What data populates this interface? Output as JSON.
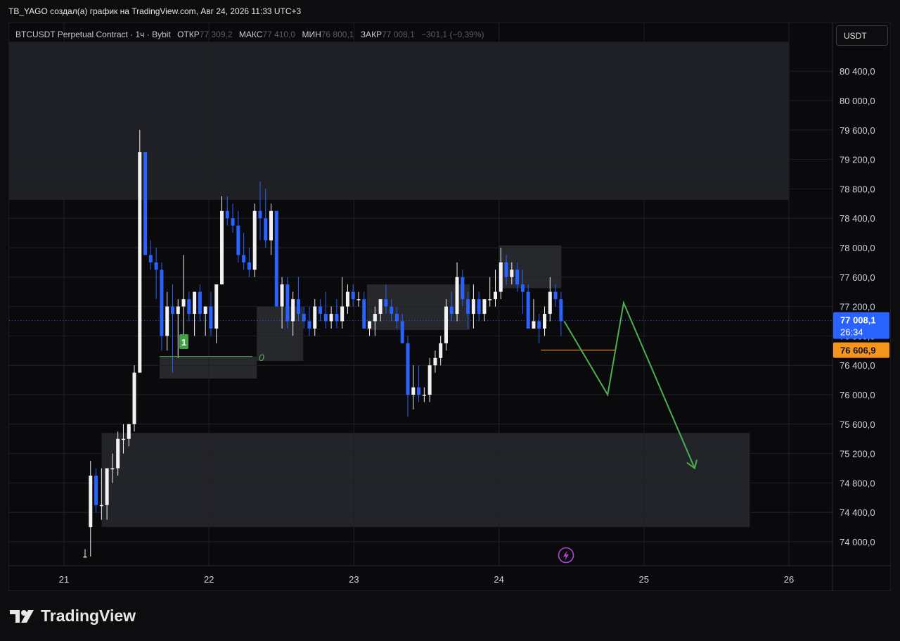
{
  "header": {
    "caption": "TB_YAGO создал(а) график на TradingView.com, Авг 24, 2026 11:33 UTC+3"
  },
  "legend": {
    "symbol": "BTCUSDT Perpetual Contract · 1ч · Bybit",
    "open_label": "ОТКР",
    "open_value": "77 309,2",
    "high_label": "МАКС",
    "high_value": "77 410,0",
    "low_label": "МИН",
    "low_value": "76 800,1",
    "close_label": "ЗАКР",
    "close_value": "77 008,1",
    "change_value": "−301,1 (−0,39%)"
  },
  "currency_button": "USDT",
  "price_badges": {
    "last_price": "77 008,1",
    "countdown": "26:34",
    "level_price": "76 606,9"
  },
  "markers": {
    "box_number": "1",
    "box_letter": "0"
  },
  "branding": {
    "name": "TradingView"
  },
  "icons": {
    "flash_icon": "lightning-icon",
    "logo_icon": "tradingview-logo-icon"
  },
  "colors": {
    "bull": "#f2f2f2",
    "bear": "#2962ff",
    "grid": "#1f2026",
    "zone": "#26272c",
    "zone_dark": "#34353b",
    "arrow": "#4caf50",
    "level_line": "#f5941d",
    "last_price_badge": "#2962ff",
    "level_badge": "#f5941d",
    "price_line": "#2962ff",
    "flash_icon": "#a64ad6"
  },
  "chart_data": {
    "type": "candlestick",
    "timeframe": "1h",
    "ylim": [
      73800,
      80800
    ],
    "y_ticks": [
      74000,
      74400,
      74800,
      75200,
      75600,
      76000,
      76400,
      76800,
      77200,
      77600,
      78000,
      78400,
      78800,
      79200,
      79600,
      80000,
      80400
    ],
    "y_tick_labels": [
      "74 000,0",
      "74 400,0",
      "74 800,0",
      "75 200,0",
      "75 600,0",
      "76 000,0",
      "76 400,0",
      "76 800,0",
      "77 200,0",
      "77 600,0",
      "78 000,0",
      "78 400,0",
      "78 800,0",
      "79 200,0",
      "79 600,0",
      "80 000,0",
      "80 400,0"
    ],
    "x_range": [
      20.25,
      26.0
    ],
    "x_ticks": [
      21,
      22,
      23,
      24,
      25,
      26
    ],
    "x_tick_labels": [
      "21",
      "22",
      "23",
      "24",
      "25",
      "26"
    ],
    "candles": [
      {
        "o": 73800,
        "h": 73900,
        "l": 73800,
        "c": 73800
      },
      {
        "o": 74200,
        "h": 75100,
        "l": 73800,
        "c": 74900
      },
      {
        "o": 74900,
        "h": 75000,
        "l": 74400,
        "c": 74500
      },
      {
        "o": 74500,
        "h": 75000,
        "l": 74300,
        "c": 74500
      },
      {
        "o": 74500,
        "h": 75000,
        "l": 74300,
        "c": 75000
      },
      {
        "o": 75000,
        "h": 75200,
        "l": 74800,
        "c": 75000
      },
      {
        "o": 75000,
        "h": 75500,
        "l": 74900,
        "c": 75400
      },
      {
        "o": 75400,
        "h": 75600,
        "l": 75200,
        "c": 75400
      },
      {
        "o": 75400,
        "h": 75600,
        "l": 75300,
        "c": 75600
      },
      {
        "o": 75600,
        "h": 76400,
        "l": 75500,
        "c": 76300
      },
      {
        "o": 76300,
        "h": 79600,
        "l": 76300,
        "c": 79300
      },
      {
        "o": 79300,
        "h": 79300,
        "l": 77900,
        "c": 77900
      },
      {
        "o": 77900,
        "h": 78100,
        "l": 77700,
        "c": 77800
      },
      {
        "o": 77800,
        "h": 78000,
        "l": 77300,
        "c": 77700
      },
      {
        "o": 77700,
        "h": 77800,
        "l": 76600,
        "c": 76800
      },
      {
        "o": 76800,
        "h": 77400,
        "l": 76600,
        "c": 77200
      },
      {
        "o": 77200,
        "h": 77500,
        "l": 76300,
        "c": 77100
      },
      {
        "o": 77100,
        "h": 77300,
        "l": 76500,
        "c": 77200
      },
      {
        "o": 77200,
        "h": 77900,
        "l": 76700,
        "c": 77300
      },
      {
        "o": 77300,
        "h": 77400,
        "l": 77000,
        "c": 77100
      },
      {
        "o": 77100,
        "h": 77400,
        "l": 76800,
        "c": 77400
      },
      {
        "o": 77400,
        "h": 77500,
        "l": 77000,
        "c": 77100
      },
      {
        "o": 77100,
        "h": 77200,
        "l": 76800,
        "c": 77200
      },
      {
        "o": 77200,
        "h": 77400,
        "l": 76800,
        "c": 76900
      },
      {
        "o": 76900,
        "h": 77500,
        "l": 76700,
        "c": 77500
      },
      {
        "o": 77500,
        "h": 78700,
        "l": 77500,
        "c": 78500
      },
      {
        "o": 78500,
        "h": 78700,
        "l": 78300,
        "c": 78400
      },
      {
        "o": 78400,
        "h": 78600,
        "l": 78200,
        "c": 78300
      },
      {
        "o": 78300,
        "h": 78500,
        "l": 77800,
        "c": 77900
      },
      {
        "o": 77900,
        "h": 78200,
        "l": 77700,
        "c": 77800
      },
      {
        "o": 77800,
        "h": 78000,
        "l": 77600,
        "c": 77700
      },
      {
        "o": 77700,
        "h": 78600,
        "l": 77600,
        "c": 78500
      },
      {
        "o": 78500,
        "h": 78900,
        "l": 78100,
        "c": 78400
      },
      {
        "o": 78400,
        "h": 78800,
        "l": 78000,
        "c": 78100
      },
      {
        "o": 78100,
        "h": 78600,
        "l": 77900,
        "c": 78500
      },
      {
        "o": 78500,
        "h": 78500,
        "l": 77200,
        "c": 77200
      },
      {
        "o": 77200,
        "h": 77600,
        "l": 76900,
        "c": 77500
      },
      {
        "o": 77500,
        "h": 77600,
        "l": 76900,
        "c": 77000
      },
      {
        "o": 77000,
        "h": 77400,
        "l": 76800,
        "c": 77300
      },
      {
        "o": 77300,
        "h": 77600,
        "l": 77000,
        "c": 77100
      },
      {
        "o": 77100,
        "h": 77200,
        "l": 76900,
        "c": 77000
      },
      {
        "o": 77000,
        "h": 77200,
        "l": 76800,
        "c": 76900
      },
      {
        "o": 76900,
        "h": 77300,
        "l": 76800,
        "c": 77200
      },
      {
        "o": 77200,
        "h": 77300,
        "l": 77000,
        "c": 77100
      },
      {
        "o": 77100,
        "h": 77400,
        "l": 76900,
        "c": 77000
      },
      {
        "o": 77000,
        "h": 77200,
        "l": 76900,
        "c": 77100
      },
      {
        "o": 77100,
        "h": 77300,
        "l": 76900,
        "c": 77000
      },
      {
        "o": 77000,
        "h": 77600,
        "l": 76900,
        "c": 77200
      },
      {
        "o": 77200,
        "h": 77500,
        "l": 77100,
        "c": 77400
      },
      {
        "o": 77400,
        "h": 77500,
        "l": 77200,
        "c": 77300
      },
      {
        "o": 77300,
        "h": 77400,
        "l": 77200,
        "c": 77300
      },
      {
        "o": 77300,
        "h": 77400,
        "l": 76900,
        "c": 76900
      },
      {
        "o": 76900,
        "h": 77000,
        "l": 76800,
        "c": 77000
      },
      {
        "o": 77000,
        "h": 77200,
        "l": 76800,
        "c": 77100
      },
      {
        "o": 77100,
        "h": 77300,
        "l": 77000,
        "c": 77300
      },
      {
        "o": 77300,
        "h": 77500,
        "l": 77100,
        "c": 77200
      },
      {
        "o": 77200,
        "h": 77300,
        "l": 77000,
        "c": 77100
      },
      {
        "o": 77100,
        "h": 77200,
        "l": 76900,
        "c": 77000
      },
      {
        "o": 77000,
        "h": 77100,
        "l": 76700,
        "c": 76700
      },
      {
        "o": 76700,
        "h": 76800,
        "l": 75700,
        "c": 76000
      },
      {
        "o": 76000,
        "h": 76400,
        "l": 75800,
        "c": 76100
      },
      {
        "o": 76100,
        "h": 76400,
        "l": 75900,
        "c": 76000
      },
      {
        "o": 76000,
        "h": 76100,
        "l": 75900,
        "c": 76000
      },
      {
        "o": 76000,
        "h": 76500,
        "l": 75900,
        "c": 76400
      },
      {
        "o": 76400,
        "h": 76600,
        "l": 76300,
        "c": 76500
      },
      {
        "o": 76500,
        "h": 76800,
        "l": 76400,
        "c": 76700
      },
      {
        "o": 76700,
        "h": 77300,
        "l": 76600,
        "c": 77200
      },
      {
        "o": 77200,
        "h": 77400,
        "l": 77000,
        "c": 77100
      },
      {
        "o": 77100,
        "h": 77800,
        "l": 77000,
        "c": 77600
      },
      {
        "o": 77600,
        "h": 77700,
        "l": 77200,
        "c": 77300
      },
      {
        "o": 77300,
        "h": 77400,
        "l": 76900,
        "c": 77100
      },
      {
        "o": 77100,
        "h": 77500,
        "l": 76900,
        "c": 77300
      },
      {
        "o": 77300,
        "h": 77400,
        "l": 77000,
        "c": 77100
      },
      {
        "o": 77100,
        "h": 77300,
        "l": 77000,
        "c": 77300
      },
      {
        "o": 77300,
        "h": 77600,
        "l": 77200,
        "c": 77300
      },
      {
        "o": 77300,
        "h": 77700,
        "l": 77200,
        "c": 77400
      },
      {
        "o": 77400,
        "h": 78000,
        "l": 77300,
        "c": 77800
      },
      {
        "o": 77800,
        "h": 77900,
        "l": 77500,
        "c": 77600
      },
      {
        "o": 77600,
        "h": 77800,
        "l": 77500,
        "c": 77700
      },
      {
        "o": 77700,
        "h": 77800,
        "l": 77400,
        "c": 77500
      },
      {
        "o": 77500,
        "h": 77700,
        "l": 77100,
        "c": 77400
      },
      {
        "o": 77400,
        "h": 77500,
        "l": 76900,
        "c": 76900
      },
      {
        "o": 76900,
        "h": 77300,
        "l": 76900,
        "c": 77000
      },
      {
        "o": 77000,
        "h": 77100,
        "l": 76700,
        "c": 76900
      },
      {
        "o": 76900,
        "h": 77200,
        "l": 76800,
        "c": 77100
      },
      {
        "o": 77100,
        "h": 77600,
        "l": 77000,
        "c": 77400
      },
      {
        "o": 77400,
        "h": 77500,
        "l": 77200,
        "c": 77300
      },
      {
        "o": 77300,
        "h": 77400,
        "l": 76800,
        "c": 77000
      }
    ],
    "zones": [
      {
        "x0": 20.25,
        "x1": 26.0,
        "y0": 78650,
        "y1": 80800
      },
      {
        "x0": 21.26,
        "x1": 25.73,
        "y0": 74200,
        "y1": 75480
      },
      {
        "x0": 21.66,
        "x1": 22.33,
        "y0": 76220,
        "y1": 76520
      },
      {
        "x0": 22.33,
        "x1": 22.65,
        "y0": 76460,
        "y1": 77200
      },
      {
        "x0": 23.09,
        "x1": 23.8,
        "y0": 76880,
        "y1": 77500
      },
      {
        "x0": 24.0,
        "x1": 24.43,
        "y0": 77450,
        "y1": 78030
      }
    ],
    "level_line": {
      "x0": 24.29,
      "x1": 24.8,
      "y": 76606.9
    },
    "green_level": {
      "x0": 21.66,
      "x1": 22.3,
      "y": 76520
    },
    "last_price": 77008.1,
    "forecast_path": [
      [
        24.45,
        77000
      ],
      [
        24.75,
        76000
      ],
      [
        24.86,
        77250
      ],
      [
        25.35,
        75000
      ]
    ]
  }
}
